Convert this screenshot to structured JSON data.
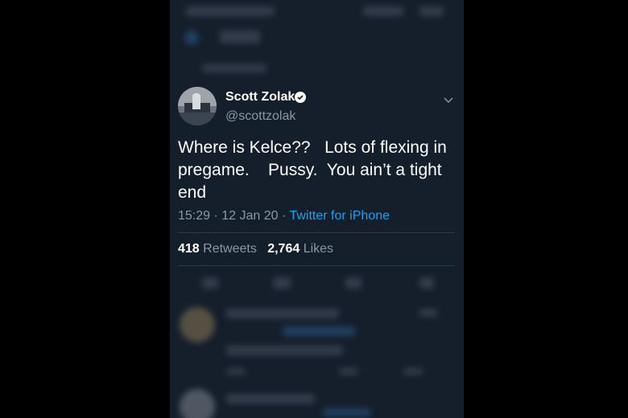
{
  "tweet": {
    "display_name": "Scott Zolak",
    "handle": "@scottzolak",
    "text": "Where is Kelce??   Lots of flexing in pregame.    Pussy.  You ain’t a tight end",
    "time": "15:29",
    "date": "12 Jan 20",
    "source": "Twitter for iPhone",
    "retweets_count": "418",
    "retweets_label": "Retweets",
    "likes_count": "2,764",
    "likes_label": "Likes",
    "verified": true
  },
  "colors": {
    "background": "#151e2b",
    "text_primary": "#ffffff",
    "text_secondary": "#8899a6",
    "accent": "#1da1f2"
  },
  "icons": [
    "verified-badge-icon",
    "chevron-down-icon",
    "avatar"
  ]
}
